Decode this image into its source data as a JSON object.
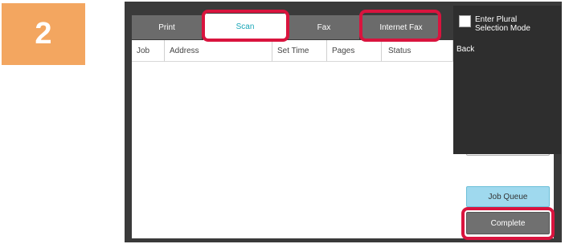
{
  "step": {
    "number": "2"
  },
  "tabs": {
    "print": "Print",
    "scan": "Scan",
    "fax": "Fax",
    "internet_fax": "Internet Fax"
  },
  "columns": {
    "job": "Job",
    "address": "Address",
    "set_time": "Set Time",
    "pages": "Pages",
    "status": "Status"
  },
  "menu": {
    "plural_line1": "Enter Plural",
    "plural_line2": "Selection Mode",
    "back": "Back"
  },
  "buttons": {
    "job_queue": "Job Queue",
    "complete": "Complete"
  },
  "colors": {
    "badge": "#f3a660",
    "highlight": "#d9143e",
    "active_tab_text": "#1aa6b7",
    "job_queue_bg": "#9fd9ee"
  }
}
